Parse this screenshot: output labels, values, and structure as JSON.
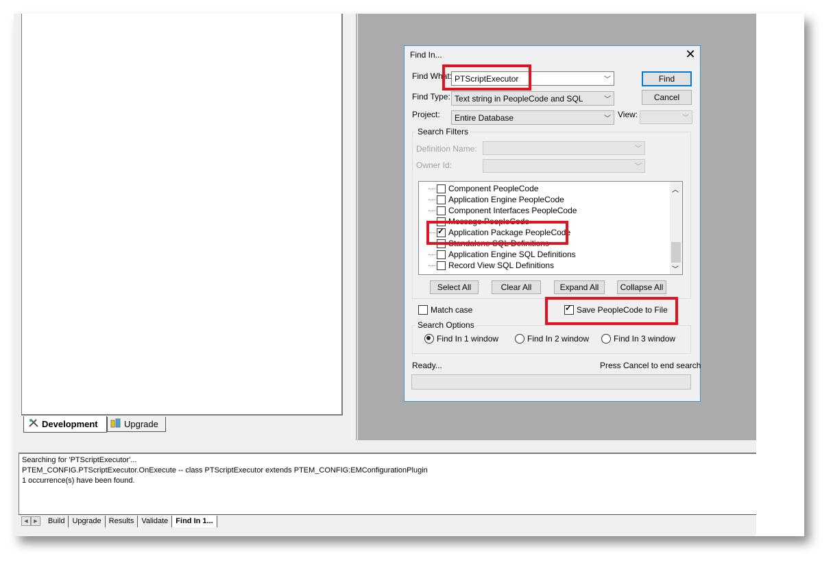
{
  "project_tabs": {
    "development": "Development",
    "upgrade": "Upgrade"
  },
  "dialog": {
    "title": "Find In...",
    "close_glyph": "✕",
    "find_what_label": "Find What:",
    "find_what_value": "PTScriptExecutor",
    "find_type_label": "Find Type:",
    "find_type_value": "Text string in PeopleCode and SQL",
    "project_label": "Project:",
    "project_value": "Entire Database",
    "view_label": "View:",
    "view_value": "",
    "find_button": "Find",
    "cancel_button": "Cancel",
    "search_filters_label": "Search Filters",
    "definition_name_label": "Definition Name:",
    "owner_id_label": "Owner Id:",
    "tree_items": [
      {
        "label": "Component PeopleCode",
        "checked": false
      },
      {
        "label": "Application Engine PeopleCode",
        "checked": false
      },
      {
        "label": "Component Interfaces PeopleCode",
        "checked": false
      },
      {
        "label": "Message PeopleCode",
        "checked": false
      },
      {
        "label": "Application Package PeopleCode",
        "checked": true
      },
      {
        "label": "Standalone SQL Definitions",
        "checked": false
      },
      {
        "label": "Application Engine SQL Definitions",
        "checked": false
      },
      {
        "label": "Record View SQL Definitions",
        "checked": false
      }
    ],
    "select_all": "Select All",
    "clear_all": "Clear All",
    "expand_all": "Expand All",
    "collapse_all": "Collapse All",
    "match_case": "Match case",
    "save_peoplecode": "Save PeopleCode to File",
    "search_options_label": "Search Options",
    "find_in_1": "Find In 1 window",
    "find_in_2": "Find In 2 window",
    "find_in_3": "Find In 3 window",
    "status": "Ready...",
    "cancel_hint": "Press Cancel to end search"
  },
  "output": {
    "lines": [
      "Searching for 'PTScriptExecutor'...",
      "PTEM_CONFIG.PTScriptExecutor.OnExecute -- class PTScriptExecutor extends PTEM_CONFIG:EMConfigurationPlugin",
      "1 occurrence(s) have been found."
    ],
    "tabs": [
      "Build",
      "Upgrade",
      "Results",
      "Validate",
      "Find In 1..."
    ]
  },
  "colors": {
    "highlight_red": "#e0141e",
    "dialog_border": "#3c8fd8"
  },
  "icons": [
    "close-icon",
    "development-icon",
    "upgrade-icon",
    "chevron-down-icon",
    "scroll-up-icon",
    "scroll-down-icon"
  ]
}
